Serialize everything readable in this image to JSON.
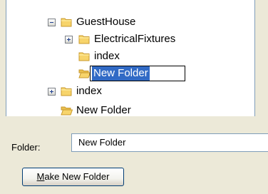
{
  "tree": {
    "items": [
      {
        "label": "GuestHouse",
        "expander": "minus"
      },
      {
        "label": "ElectricalFixtures",
        "expander": "plus"
      },
      {
        "label": "index",
        "expander": "none"
      },
      {
        "label": "New Folder",
        "expander": "none",
        "editing": true
      },
      {
        "label": "index",
        "expander": "plus"
      },
      {
        "label": "New Folder",
        "expander": "none"
      }
    ]
  },
  "folder_field": {
    "label": "Folder:",
    "value": "New Folder"
  },
  "make_button": {
    "accel": "M",
    "rest": "ake New Folder"
  },
  "colors": {
    "folder_fill": "#f7d46b",
    "folder_edge": "#c99a2e",
    "selection": "#316ac5",
    "dialog_bg": "#ece9d8",
    "field_border": "#7f9db9"
  }
}
